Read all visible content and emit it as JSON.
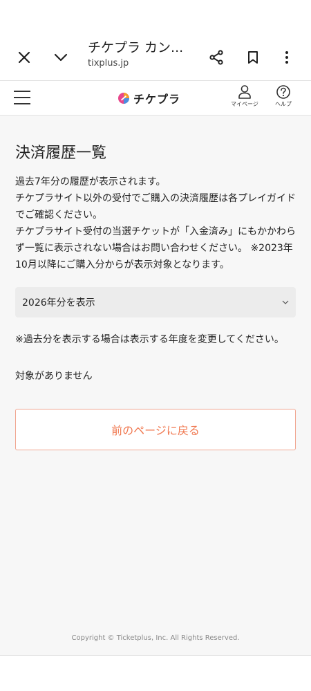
{
  "browser": {
    "title": "チケプラ カン...",
    "url": "tixplus.jp",
    "icons": [
      "close-icon",
      "chevron-down-icon",
      "share-icon",
      "bookmark-icon",
      "more-vert-icon"
    ]
  },
  "header": {
    "logo_text": "チケプラ",
    "mypage_label": "マイページ",
    "help_label": "ヘルプ",
    "icons": [
      "menu-icon",
      "logo-icon",
      "user-icon",
      "help-icon"
    ]
  },
  "main": {
    "title": "決済履歴一覧",
    "description": [
      "過去7年分の履歴が表示されます。",
      "チケプラサイト以外の受付でご購入の決済履歴は各プレイガイドでご確認ください。",
      "チケプラサイト受付の当選チケットが「入金済み」にもかかわらず一覧に表示されない場合はお問い合わせください。 ※2023年10月以降にご購入分からが表示対象となります。"
    ],
    "year_select": "2026年分を表示",
    "note": "※過去分を表示する場合は表示する年度を変更してください。",
    "empty_message": "対象がありません",
    "back_button": "前のページに戻る"
  },
  "footer": {
    "copyright": "Copyright © Ticketplus, Inc. All Rights Reserved."
  },
  "colors": {
    "accent": "#f07850",
    "accent_border": "#f0a590",
    "background": "#f7f7f7"
  }
}
